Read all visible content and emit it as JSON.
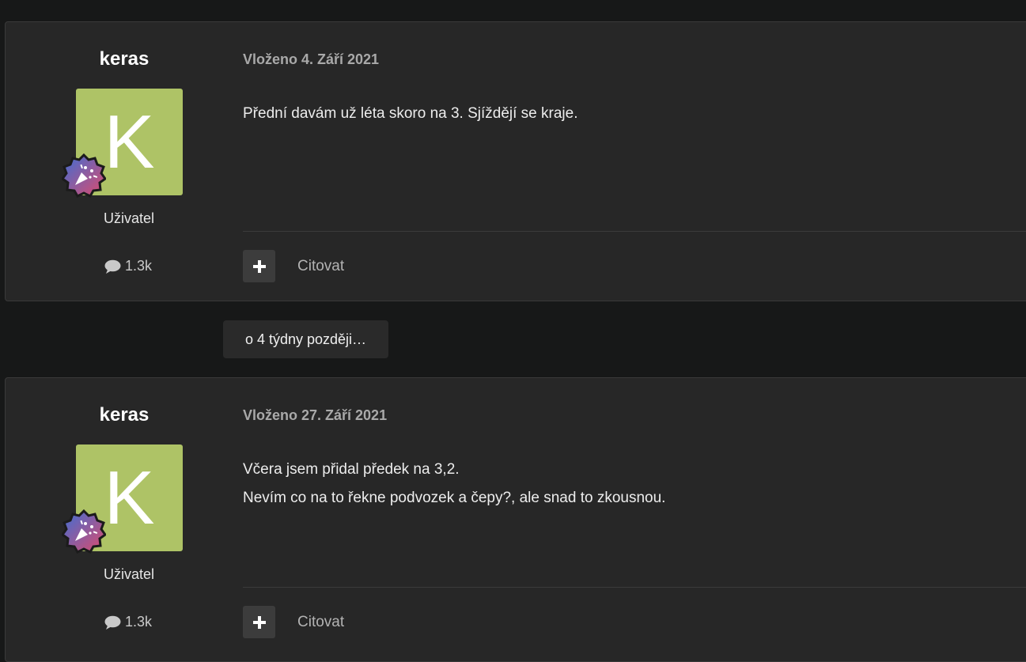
{
  "posts": [
    {
      "author": "keras",
      "avatar_letter": "K",
      "avatar_color": "#aec366",
      "badge_icon": "party-popper-icon",
      "role": "Uživatel",
      "post_count": "1.3k",
      "date": "Vloženo 4. Září 2021",
      "body_lines": [
        "Přední davám už léta skoro na 3. Sjíždějí se kraje.",
        ""
      ],
      "plus_icon": "plus-icon",
      "quote_label": "Citovat"
    },
    {
      "author": "keras",
      "avatar_letter": "K",
      "avatar_color": "#aec366",
      "badge_icon": "party-popper-icon",
      "role": "Uživatel",
      "post_count": "1.3k",
      "date": "Vloženo 27. Září 2021",
      "body_lines": [
        "Včera jsem přidal předek na 3,2.",
        "Nevím co na to řekne podvozek a čepy?, ale snad to zkousnou."
      ],
      "plus_icon": "plus-icon",
      "quote_label": "Citovat"
    }
  ],
  "time_gap_label": "o 4 týdny později…",
  "colors": {
    "page_background": "#171818",
    "card_background": "#272727",
    "badge_gradient": [
      "#3b6fd6",
      "#e04a6a"
    ]
  }
}
